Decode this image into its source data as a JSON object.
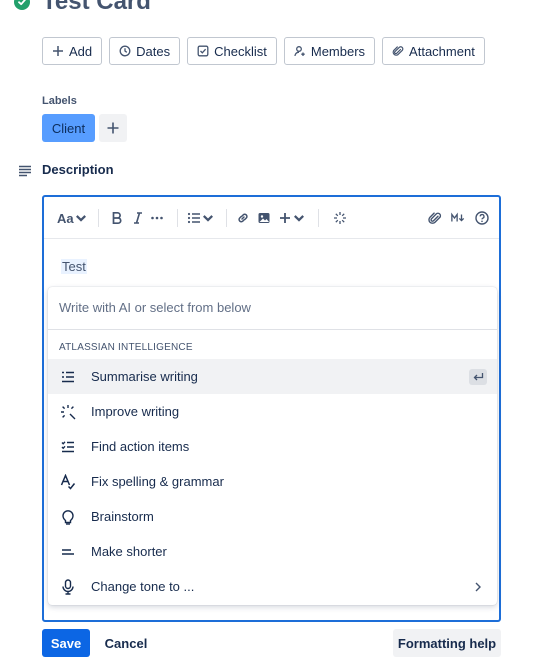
{
  "card": {
    "title": "Test Card"
  },
  "actions": [
    {
      "label": "Add",
      "icon": "plus-icon"
    },
    {
      "label": "Dates",
      "icon": "clock-icon"
    },
    {
      "label": "Checklist",
      "icon": "checkbox-icon"
    },
    {
      "label": "Members",
      "icon": "add-person-icon"
    },
    {
      "label": "Attachment",
      "icon": "paperclip-icon"
    }
  ],
  "labels": {
    "title": "Labels",
    "items": [
      {
        "text": "Client",
        "color": "#579dff"
      }
    ]
  },
  "description": {
    "title": "Description"
  },
  "toolbar": {
    "text_style": "Aa"
  },
  "editor": {
    "content": "Test"
  },
  "ai": {
    "placeholder": "Write with AI or select from below",
    "section": "ATLASSIAN INTELLIGENCE",
    "items": [
      {
        "label": "Summarise writing",
        "icon": "summarise-icon"
      },
      {
        "label": "Improve writing",
        "icon": "sparkle-icon"
      },
      {
        "label": "Find action items",
        "icon": "checklist-icon"
      },
      {
        "label": "Fix spelling & grammar",
        "icon": "spellcheck-icon"
      },
      {
        "label": "Brainstorm",
        "icon": "lightbulb-icon"
      },
      {
        "label": "Make shorter",
        "icon": "shorten-icon"
      },
      {
        "label": "Change tone to ...",
        "icon": "microphone-icon"
      }
    ]
  },
  "footer": {
    "save": "Save",
    "cancel": "Cancel",
    "formatting_help": "Formatting help"
  },
  "colors": {
    "primary": "#0c66e4",
    "editor_border": "#1d6ed8",
    "success": "#22a06b"
  }
}
